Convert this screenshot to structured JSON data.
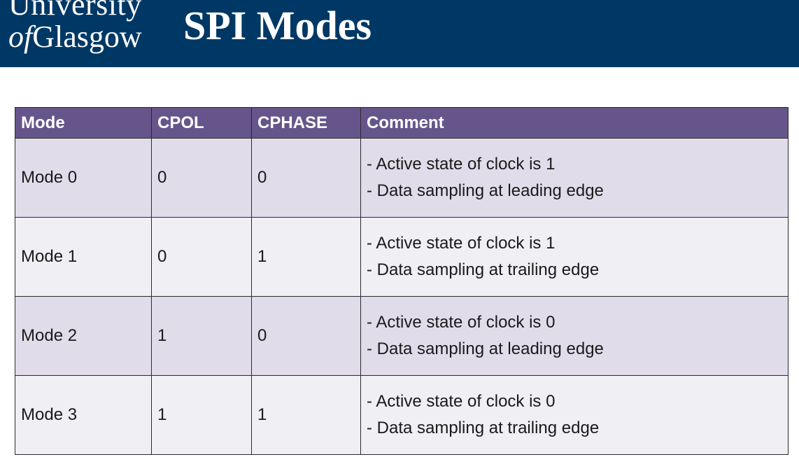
{
  "header": {
    "logo_line1": "University",
    "logo_of": "of",
    "logo_line2": "Glasgow",
    "title": "SPI Modes",
    "background_color": "#003865"
  },
  "table": {
    "header_color": "#66558a",
    "columns": [
      "Mode",
      "CPOL",
      "CPHASE",
      "Comment"
    ],
    "rows": [
      {
        "mode": "Mode 0",
        "cpol": "0",
        "cphase": "0",
        "comment": [
          "- Active state of clock is 1",
          "- Data sampling at leading edge"
        ]
      },
      {
        "mode": "Mode 1",
        "cpol": "0",
        "cphase": "1",
        "comment": [
          "- Active state of clock is 1",
          "- Data sampling at trailing edge"
        ]
      },
      {
        "mode": "Mode 2",
        "cpol": "1",
        "cphase": "0",
        "comment": [
          "- Active state of clock is 0",
          "- Data sampling at leading edge"
        ]
      },
      {
        "mode": "Mode 3",
        "cpol": "1",
        "cphase": "1",
        "comment": [
          "- Active state of clock is 0",
          "- Data sampling at trailing edge"
        ]
      }
    ]
  }
}
